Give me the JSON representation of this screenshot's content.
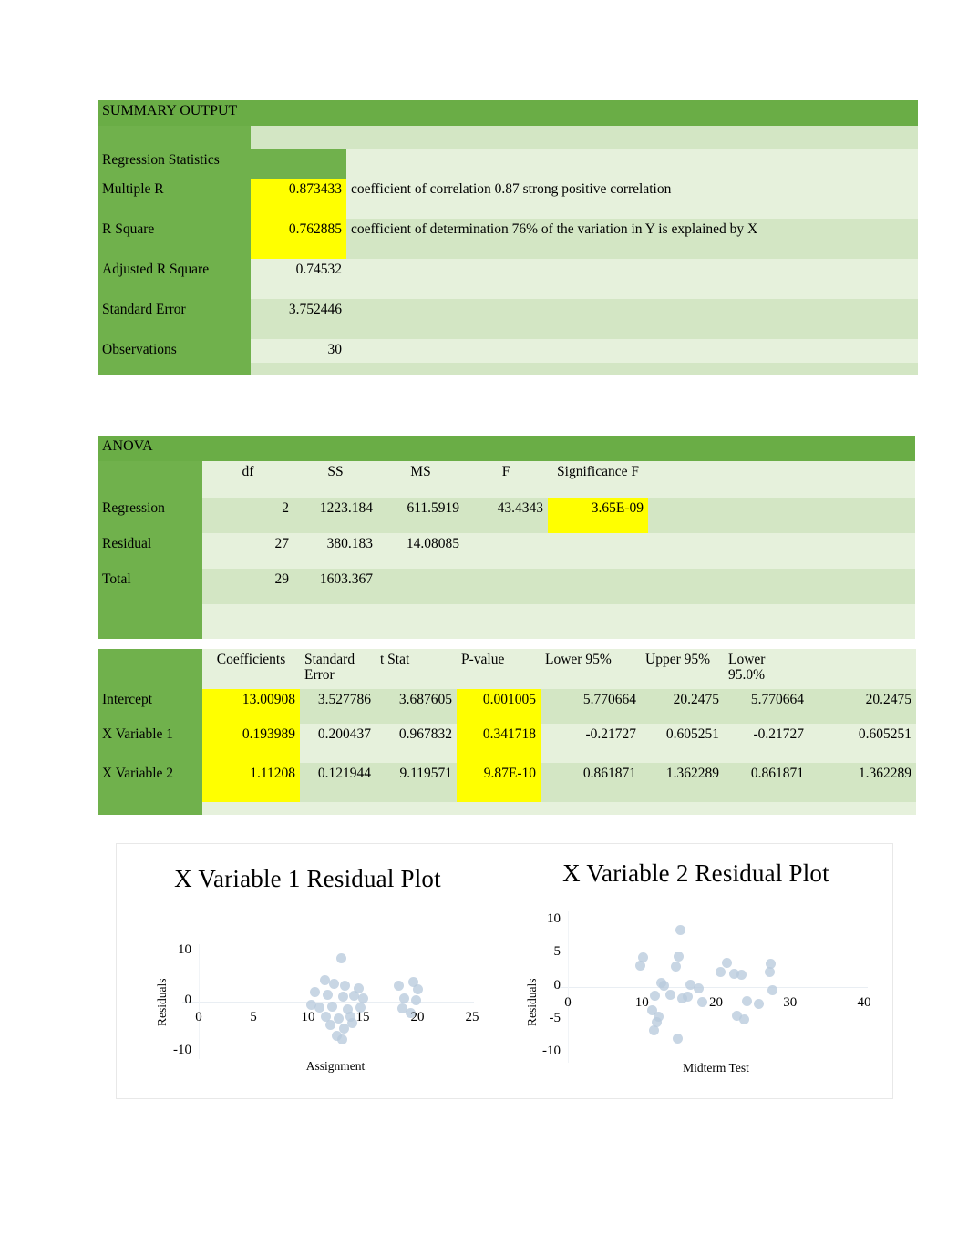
{
  "summary": {
    "title": "SUMMARY OUTPUT",
    "section_header": "Regression Statistics",
    "rows": [
      {
        "label": "Multiple R",
        "value": "0.873433",
        "highlight": true,
        "note": "coefficient of correlation 0.87 strong positive correlation"
      },
      {
        "label": "R Square",
        "value": "0.762885",
        "highlight": true,
        "note": "coefficient of determination 76% of the variation in Y is explained by X"
      },
      {
        "label": "Adjusted R Square",
        "value": "0.74532",
        "highlight": false,
        "note": ""
      },
      {
        "label": "Standard Error",
        "value": "3.752446",
        "highlight": false,
        "note": ""
      },
      {
        "label": "Observations",
        "value": "30",
        "highlight": false,
        "note": ""
      }
    ]
  },
  "anova": {
    "title": "ANOVA",
    "columns": [
      "",
      "df",
      "SS",
      "MS",
      "F",
      "Significance F"
    ],
    "rows": [
      {
        "label": "Regression",
        "df": "2",
        "ss": "1223.184",
        "ms": "611.5919",
        "f": "43.4343",
        "sig": "3.65E-09"
      },
      {
        "label": "Residual",
        "df": "27",
        "ss": "380.183",
        "ms": "14.08085",
        "f": "",
        "sig": ""
      },
      {
        "label": "Total",
        "df": "29",
        "ss": "1603.367",
        "ms": "",
        "f": "",
        "sig": ""
      }
    ]
  },
  "coefficients": {
    "columns": [
      "",
      "Coefficients",
      "Standard Error",
      "t Stat",
      "P-value",
      "Lower 95%",
      "Upper 95%",
      "Lower 95.0%",
      ""
    ],
    "rows": [
      {
        "label": "Intercept",
        "coef": "13.00908",
        "se": "3.527786",
        "tstat": "3.687605",
        "pvalue": "0.001005",
        "lower95": "5.770664",
        "upper95": "20.2475",
        "lower950": "5.770664",
        "upper950": "20.2475"
      },
      {
        "label": "X Variable 1",
        "coef": "0.193989",
        "se": "0.200437",
        "tstat": "0.967832",
        "pvalue": "0.341718",
        "lower95": "-0.21727",
        "upper95": "0.605251",
        "lower950": "-0.21727",
        "upper950": "0.605251"
      },
      {
        "label": "X Variable 2",
        "coef": "1.11208",
        "se": "0.121944",
        "tstat": "9.119571",
        "pvalue": "9.87E-10",
        "lower95": "0.861871",
        "upper95": "1.362289",
        "lower950": "0.861871",
        "upper950": "1.362289"
      }
    ]
  },
  "colors": {
    "header_green": "#6aad46",
    "label_green": "#70b14c",
    "row_light": "#e6f1dc",
    "row_light_alt": "#d3e6c4",
    "highlight_yellow": "#ffff00",
    "marker_blue": "#b9cbdd"
  },
  "chart_data": [
    {
      "type": "scatter",
      "title": "X Variable 1  Residual Plot",
      "xlabel": "Assignment",
      "ylabel": "Residuals",
      "xlim": [
        0,
        25
      ],
      "ylim": [
        -10,
        10
      ],
      "xticks": [
        0,
        5,
        10,
        15,
        20,
        25
      ],
      "yticks": [
        -10,
        0,
        10
      ],
      "grid": false,
      "legend": "none",
      "points": [
        {
          "x": 13.0,
          "y": 8.6
        },
        {
          "x": 11.5,
          "y": 4.2
        },
        {
          "x": 12.4,
          "y": 3.6
        },
        {
          "x": 13.4,
          "y": 3.2
        },
        {
          "x": 14.6,
          "y": 2.6
        },
        {
          "x": 18.3,
          "y": 3.1
        },
        {
          "x": 19.6,
          "y": 4.0
        },
        {
          "x": 20.0,
          "y": 2.5
        },
        {
          "x": 10.6,
          "y": 2.0
        },
        {
          "x": 11.8,
          "y": 1.4
        },
        {
          "x": 13.2,
          "y": 1.0
        },
        {
          "x": 14.2,
          "y": 1.2
        },
        {
          "x": 15.0,
          "y": 0.6
        },
        {
          "x": 18.8,
          "y": 0.6
        },
        {
          "x": 19.9,
          "y": 0.2
        },
        {
          "x": 10.3,
          "y": -0.6
        },
        {
          "x": 11.0,
          "y": -1.2
        },
        {
          "x": 12.2,
          "y": -1.0
        },
        {
          "x": 13.6,
          "y": -1.6
        },
        {
          "x": 14.8,
          "y": -1.1
        },
        {
          "x": 18.6,
          "y": -1.4
        },
        {
          "x": 19.4,
          "y": -2.2
        },
        {
          "x": 11.6,
          "y": -3.0
        },
        {
          "x": 12.8,
          "y": -3.4
        },
        {
          "x": 13.9,
          "y": -3.0
        },
        {
          "x": 12.0,
          "y": -4.6
        },
        {
          "x": 13.3,
          "y": -5.4
        },
        {
          "x": 14.0,
          "y": -4.2
        },
        {
          "x": 12.6,
          "y": -6.8
        },
        {
          "x": 13.1,
          "y": -7.6
        }
      ]
    },
    {
      "type": "scatter",
      "title": "X Variable 2  Residual Plot",
      "xlabel": "Midterm Test",
      "ylabel": "Residuals",
      "xlim": [
        0,
        40
      ],
      "ylim": [
        -10,
        10
      ],
      "xticks": [
        0,
        10,
        20,
        30,
        40
      ],
      "yticks": [
        -10,
        -5,
        0,
        5,
        10
      ],
      "grid": false,
      "legend": "none",
      "points": [
        {
          "x": 15.2,
          "y": 8.6
        },
        {
          "x": 10.2,
          "y": 4.4
        },
        {
          "x": 15.0,
          "y": 4.5
        },
        {
          "x": 21.5,
          "y": 3.6
        },
        {
          "x": 27.4,
          "y": 3.4
        },
        {
          "x": 9.8,
          "y": 3.2
        },
        {
          "x": 14.6,
          "y": 3.0
        },
        {
          "x": 20.6,
          "y": 2.2
        },
        {
          "x": 22.4,
          "y": 2.0
        },
        {
          "x": 23.4,
          "y": 1.8
        },
        {
          "x": 27.2,
          "y": 2.2
        },
        {
          "x": 12.6,
          "y": 0.6
        },
        {
          "x": 13.0,
          "y": 0.1
        },
        {
          "x": 16.6,
          "y": 0.3
        },
        {
          "x": 17.6,
          "y": -0.3
        },
        {
          "x": 27.6,
          "y": -0.6
        },
        {
          "x": 11.8,
          "y": -1.4
        },
        {
          "x": 13.8,
          "y": -1.2
        },
        {
          "x": 15.4,
          "y": -1.8
        },
        {
          "x": 16.2,
          "y": -1.5
        },
        {
          "x": 18.2,
          "y": -2.4
        },
        {
          "x": 24.2,
          "y": -2.2
        },
        {
          "x": 25.8,
          "y": -2.6
        },
        {
          "x": 11.4,
          "y": -3.6
        },
        {
          "x": 12.2,
          "y": -4.6
        },
        {
          "x": 12.0,
          "y": -5.4
        },
        {
          "x": 22.8,
          "y": -4.4
        },
        {
          "x": 23.8,
          "y": -5.0
        },
        {
          "x": 11.6,
          "y": -6.6
        },
        {
          "x": 14.8,
          "y": -7.8
        }
      ]
    }
  ]
}
